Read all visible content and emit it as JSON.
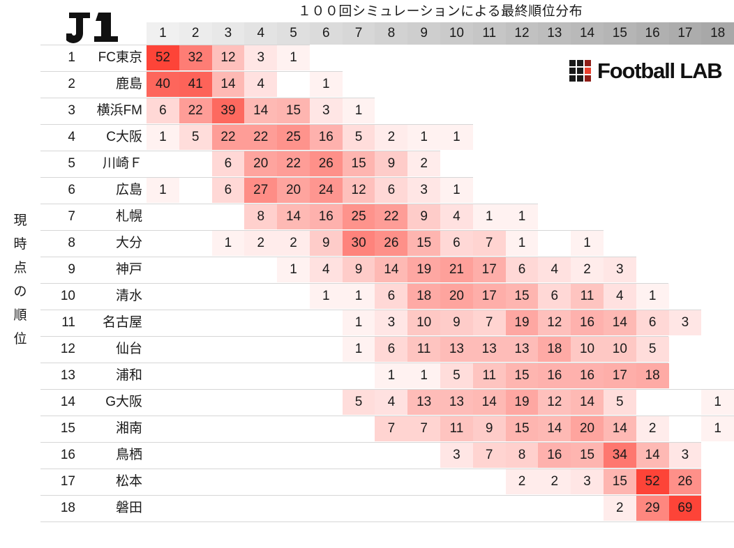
{
  "title": "１００回シミュレーションによる最終順位分布",
  "league_badge": "J1",
  "brand": {
    "wordmark": "Football LAB",
    "grid_colors": [
      "#1a1a1a",
      "#1a1a1a",
      "#8f1d17",
      "#1a1a1a",
      "#1a1a1a",
      "#e8402e",
      "#1a1a1a",
      "#1a1a1a",
      "#8f1d17"
    ]
  },
  "y_axis_caption": [
    "現",
    "時",
    "点",
    "の",
    "順",
    "位"
  ],
  "colors": {
    "cell_max": "#fd4438",
    "cell_min": "#fffafa",
    "header_start": "#f0f0f0",
    "header_end": "#a8a8a8",
    "row_separator": "#d6d6d6"
  },
  "column_headers": [
    "1",
    "2",
    "3",
    "4",
    "5",
    "6",
    "7",
    "8",
    "9",
    "10",
    "11",
    "12",
    "13",
    "14",
    "15",
    "16",
    "17",
    "18"
  ],
  "rows": [
    {
      "rank": "1",
      "team": "FC東京",
      "values": [
        52,
        32,
        12,
        3,
        1,
        null,
        null,
        null,
        null,
        null,
        null,
        null,
        null,
        null,
        null,
        null,
        null,
        null
      ]
    },
    {
      "rank": "2",
      "team": "鹿島",
      "values": [
        40,
        41,
        14,
        4,
        null,
        1,
        null,
        null,
        null,
        null,
        null,
        null,
        null,
        null,
        null,
        null,
        null,
        null
      ]
    },
    {
      "rank": "3",
      "team": "横浜FM",
      "values": [
        6,
        22,
        39,
        14,
        15,
        3,
        1,
        null,
        null,
        null,
        null,
        null,
        null,
        null,
        null,
        null,
        null,
        null
      ]
    },
    {
      "rank": "4",
      "team": "C大阪",
      "values": [
        1,
        5,
        22,
        22,
        25,
        16,
        5,
        2,
        1,
        1,
        null,
        null,
        null,
        null,
        null,
        null,
        null,
        null
      ]
    },
    {
      "rank": "5",
      "team": "川崎Ｆ",
      "values": [
        null,
        null,
        6,
        20,
        22,
        26,
        15,
        9,
        2,
        null,
        null,
        null,
        null,
        null,
        null,
        null,
        null,
        null
      ]
    },
    {
      "rank": "6",
      "team": "広島",
      "values": [
        1,
        null,
        6,
        27,
        20,
        24,
        12,
        6,
        3,
        1,
        null,
        null,
        null,
        null,
        null,
        null,
        null,
        null
      ]
    },
    {
      "rank": "7",
      "team": "札幌",
      "values": [
        null,
        null,
        null,
        8,
        14,
        16,
        25,
        22,
        9,
        4,
        1,
        1,
        null,
        null,
        null,
        null,
        null,
        null
      ]
    },
    {
      "rank": "8",
      "team": "大分",
      "values": [
        null,
        null,
        1,
        2,
        2,
        9,
        30,
        26,
        15,
        6,
        7,
        1,
        null,
        1,
        null,
        null,
        null,
        null
      ]
    },
    {
      "rank": "9",
      "team": "神戸",
      "values": [
        null,
        null,
        null,
        null,
        1,
        4,
        9,
        14,
        19,
        21,
        17,
        6,
        4,
        2,
        3,
        null,
        null,
        null
      ]
    },
    {
      "rank": "10",
      "team": "清水",
      "values": [
        null,
        null,
        null,
        null,
        null,
        1,
        1,
        6,
        18,
        20,
        17,
        15,
        6,
        11,
        4,
        1,
        null,
        null
      ]
    },
    {
      "rank": "11",
      "team": "名古屋",
      "values": [
        null,
        null,
        null,
        null,
        null,
        null,
        1,
        3,
        10,
        9,
        7,
        19,
        12,
        16,
        14,
        6,
        3,
        null
      ]
    },
    {
      "rank": "12",
      "team": "仙台",
      "values": [
        null,
        null,
        null,
        null,
        null,
        null,
        1,
        6,
        11,
        13,
        13,
        13,
        18,
        10,
        10,
        5,
        null,
        null
      ]
    },
    {
      "rank": "13",
      "team": "浦和",
      "values": [
        null,
        null,
        null,
        null,
        null,
        null,
        null,
        1,
        1,
        5,
        11,
        15,
        16,
        16,
        17,
        18,
        null,
        null
      ]
    },
    {
      "rank": "14",
      "team": "G大阪",
      "values": [
        null,
        null,
        null,
        null,
        null,
        null,
        5,
        4,
        13,
        13,
        14,
        19,
        12,
        14,
        5,
        null,
        null,
        1
      ]
    },
    {
      "rank": "15",
      "team": "湘南",
      "values": [
        null,
        null,
        null,
        null,
        null,
        null,
        null,
        7,
        7,
        11,
        9,
        15,
        14,
        20,
        14,
        2,
        null,
        1
      ]
    },
    {
      "rank": "16",
      "team": "鳥栖",
      "values": [
        null,
        null,
        null,
        null,
        null,
        null,
        null,
        null,
        null,
        3,
        7,
        8,
        16,
        15,
        34,
        14,
        3,
        null
      ]
    },
    {
      "rank": "17",
      "team": "松本",
      "values": [
        null,
        null,
        null,
        null,
        null,
        null,
        null,
        null,
        null,
        null,
        null,
        2,
        2,
        3,
        15,
        52,
        26,
        null
      ]
    },
    {
      "rank": "18",
      "team": "磐田",
      "values": [
        null,
        null,
        null,
        null,
        null,
        null,
        null,
        null,
        null,
        null,
        null,
        null,
        null,
        null,
        2,
        29,
        69,
        null
      ]
    }
  ],
  "chart_data": {
    "type": "heatmap",
    "title": "１００回シミュレーションによる最終順位分布",
    "xlabel": "",
    "ylabel": "現時点の順位",
    "x_categories": [
      "1",
      "2",
      "3",
      "4",
      "5",
      "6",
      "7",
      "8",
      "9",
      "10",
      "11",
      "12",
      "13",
      "14",
      "15",
      "16",
      "17",
      "18"
    ],
    "y_categories": [
      "FC東京",
      "鹿島",
      "横浜FM",
      "C大阪",
      "川崎Ｆ",
      "広島",
      "札幌",
      "大分",
      "神戸",
      "清水",
      "名古屋",
      "仙台",
      "浦和",
      "G大阪",
      "湘南",
      "鳥栖",
      "松本",
      "磐田"
    ],
    "value_range": [
      0,
      69
    ],
    "unit": "回 (out of 100 simulations)",
    "grid": false,
    "legend": "none",
    "matrix": [
      [
        52,
        32,
        12,
        3,
        1,
        0,
        0,
        0,
        0,
        0,
        0,
        0,
        0,
        0,
        0,
        0,
        0,
        0
      ],
      [
        40,
        41,
        14,
        4,
        0,
        1,
        0,
        0,
        0,
        0,
        0,
        0,
        0,
        0,
        0,
        0,
        0,
        0
      ],
      [
        6,
        22,
        39,
        14,
        15,
        3,
        1,
        0,
        0,
        0,
        0,
        0,
        0,
        0,
        0,
        0,
        0,
        0
      ],
      [
        1,
        5,
        22,
        22,
        25,
        16,
        5,
        2,
        1,
        1,
        0,
        0,
        0,
        0,
        0,
        0,
        0,
        0
      ],
      [
        0,
        0,
        6,
        20,
        22,
        26,
        15,
        9,
        2,
        0,
        0,
        0,
        0,
        0,
        0,
        0,
        0,
        0
      ],
      [
        1,
        0,
        6,
        27,
        20,
        24,
        12,
        6,
        3,
        1,
        0,
        0,
        0,
        0,
        0,
        0,
        0,
        0
      ],
      [
        0,
        0,
        0,
        8,
        14,
        16,
        25,
        22,
        9,
        4,
        1,
        1,
        0,
        0,
        0,
        0,
        0,
        0
      ],
      [
        0,
        0,
        1,
        2,
        2,
        9,
        30,
        26,
        15,
        6,
        7,
        1,
        0,
        1,
        0,
        0,
        0,
        0
      ],
      [
        0,
        0,
        0,
        0,
        1,
        4,
        9,
        14,
        19,
        21,
        17,
        6,
        4,
        2,
        3,
        0,
        0,
        0
      ],
      [
        0,
        0,
        0,
        0,
        0,
        1,
        1,
        6,
        18,
        20,
        17,
        15,
        6,
        11,
        4,
        1,
        0,
        0
      ],
      [
        0,
        0,
        0,
        0,
        0,
        0,
        1,
        3,
        10,
        9,
        7,
        19,
        12,
        16,
        14,
        6,
        3,
        0
      ],
      [
        0,
        0,
        0,
        0,
        0,
        0,
        1,
        6,
        11,
        13,
        13,
        13,
        18,
        10,
        10,
        5,
        0,
        0
      ],
      [
        0,
        0,
        0,
        0,
        0,
        0,
        0,
        1,
        1,
        5,
        11,
        15,
        16,
        16,
        17,
        18,
        0,
        0
      ],
      [
        0,
        0,
        0,
        0,
        0,
        0,
        5,
        4,
        13,
        13,
        14,
        19,
        12,
        14,
        5,
        0,
        0,
        1
      ],
      [
        0,
        0,
        0,
        0,
        0,
        0,
        0,
        7,
        7,
        11,
        9,
        15,
        14,
        20,
        14,
        2,
        0,
        1
      ],
      [
        0,
        0,
        0,
        0,
        0,
        0,
        0,
        0,
        0,
        3,
        7,
        8,
        16,
        15,
        34,
        14,
        3,
        0
      ],
      [
        0,
        0,
        0,
        0,
        0,
        0,
        0,
        0,
        0,
        0,
        0,
        2,
        2,
        3,
        15,
        52,
        26,
        0
      ],
      [
        0,
        0,
        0,
        0,
        0,
        0,
        0,
        0,
        0,
        0,
        0,
        0,
        0,
        0,
        2,
        29,
        69,
        0
      ]
    ]
  }
}
